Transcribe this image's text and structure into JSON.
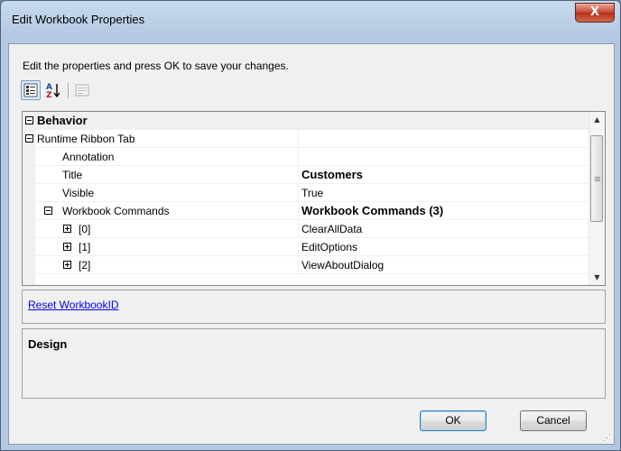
{
  "window": {
    "title": "Edit Workbook Properties",
    "close_glyph": "X"
  },
  "instruction": "Edit the properties and press OK to save your changes.",
  "toolbar": {
    "categorized_icon": "categorized-view-icon",
    "alphabetical_icon": "alphabetical-sort-icon",
    "property_pages_icon": "property-pages-icon"
  },
  "grid": {
    "rows": [
      {
        "name": "Behavior",
        "value": "",
        "type": "category",
        "expander": "collapse"
      },
      {
        "name": "Runtime Ribbon Tab",
        "value": "",
        "type": "expandable",
        "expander": "collapse"
      },
      {
        "name": "Annotation",
        "value": "",
        "type": "property"
      },
      {
        "name": "Title",
        "value": "Customers",
        "type": "property",
        "bold_value": true
      },
      {
        "name": "Visible",
        "value": "True",
        "type": "property"
      },
      {
        "name": "Workbook Commands",
        "value": "Workbook Commands (3)",
        "type": "expandable",
        "expander": "collapse",
        "bold_value": true
      },
      {
        "name": "[0]",
        "value": "ClearAllData",
        "type": "item",
        "expander": "expand"
      },
      {
        "name": "[1]",
        "value": "EditOptions",
        "type": "item",
        "expander": "expand"
      },
      {
        "name": "[2]",
        "value": "ViewAboutDialog",
        "type": "item",
        "expander": "expand"
      }
    ]
  },
  "commands": {
    "reset_link": "Reset WorkbookID"
  },
  "description": {
    "title": "Design"
  },
  "buttons": {
    "ok": "OK",
    "cancel": "Cancel"
  },
  "colors": {
    "link": "#0000ee",
    "close_button": "#c7452f",
    "title_bar": "#b3c9e2"
  }
}
